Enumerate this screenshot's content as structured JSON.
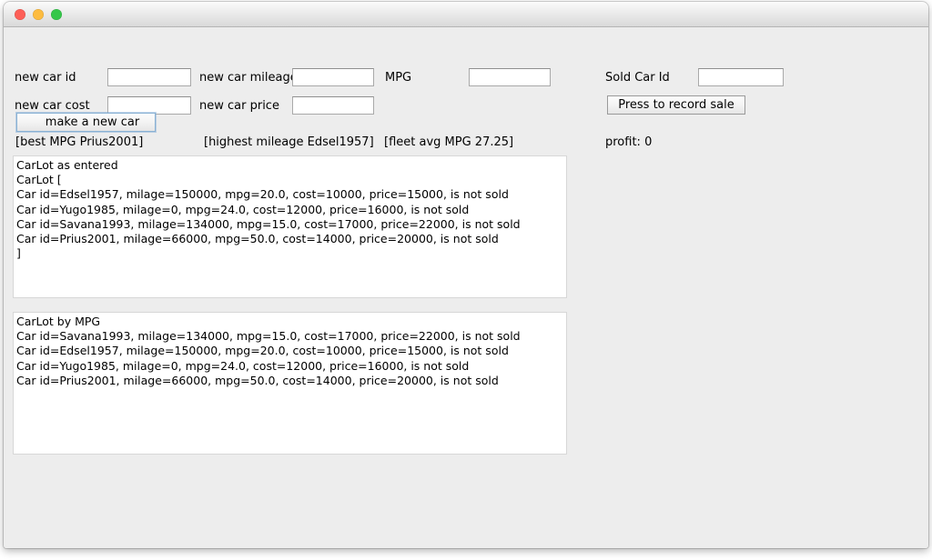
{
  "window": {
    "controls": [
      {
        "name": "close",
        "color": "#fd5f57"
      },
      {
        "name": "minimize",
        "color": "#fdbc40"
      },
      {
        "name": "zoom",
        "color": "#34c749"
      }
    ]
  },
  "form": {
    "new_car_id_label": "new car id",
    "new_car_id_value": "",
    "new_car_mileage_label": "new car mileage",
    "new_car_mileage_value": "",
    "mpg_label": "MPG",
    "mpg_value": "",
    "new_car_cost_label": "new car cost",
    "new_car_cost_value": "",
    "new_car_price_label": "new car price",
    "new_car_price_value": "",
    "make_car_button": "make a new car",
    "sold_car_id_label": "Sold Car Id",
    "sold_car_id_value": "",
    "record_sale_button": "Press to record sale"
  },
  "status": {
    "best_mpg": "[best MPG Prius2001]",
    "highest_mileage": "[highest mileage Edsel1957]",
    "fleet_avg_mpg": "[fleet avg MPG 27.25]",
    "profit": "profit: 0"
  },
  "panels": {
    "as_entered": "CarLot as entered\nCarLot [\nCar id=Edsel1957, milage=150000, mpg=20.0, cost=10000, price=15000, is not sold\nCar id=Yugo1985, milage=0, mpg=24.0, cost=12000, price=16000, is not sold\nCar id=Savana1993, milage=134000, mpg=15.0, cost=17000, price=22000, is not sold\nCar id=Prius2001, milage=66000, mpg=50.0, cost=14000, price=20000, is not sold\n]",
    "by_mpg": "CarLot by MPG\nCar id=Savana1993, milage=134000, mpg=15.0, cost=17000, price=22000, is not sold\nCar id=Edsel1957, milage=150000, mpg=20.0, cost=10000, price=15000, is not sold\nCar id=Yugo1985, milage=0, mpg=24.0, cost=12000, price=16000, is not sold\nCar id=Prius2001, milage=66000, mpg=50.0, cost=14000, price=20000, is not sold"
  }
}
